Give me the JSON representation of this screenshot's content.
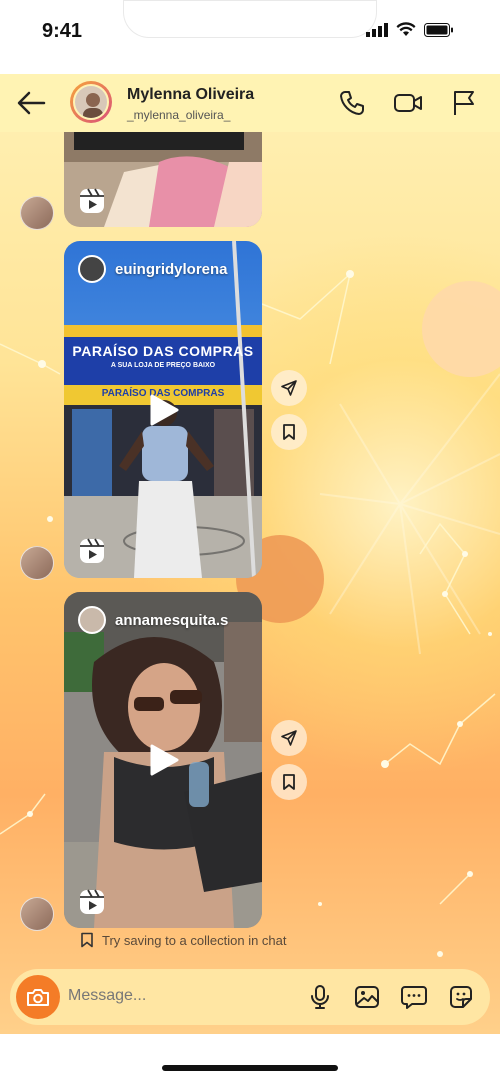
{
  "status_bar": {
    "time": "9:41"
  },
  "header": {
    "name": "Mylenna Oliveira",
    "username": "_mylenna_oliveira_"
  },
  "messages": [
    {
      "poster": "",
      "type": "reel"
    },
    {
      "poster": "euingridylorena",
      "type": "reel",
      "sign_text": "PARAÍSO DAS COMPRAS",
      "sign_sub": "A SUA LOJA DE PREÇO BAIXO",
      "sign_text2": "PARAÍSO DAS COMPRAS"
    },
    {
      "poster": "annamesquita.s",
      "type": "reel"
    }
  ],
  "hint": {
    "text": "Try saving to a collection in chat"
  },
  "composer": {
    "placeholder": "Message..."
  },
  "colors": {
    "accent": "#f47c27",
    "header_bg": "#fff3b3"
  }
}
